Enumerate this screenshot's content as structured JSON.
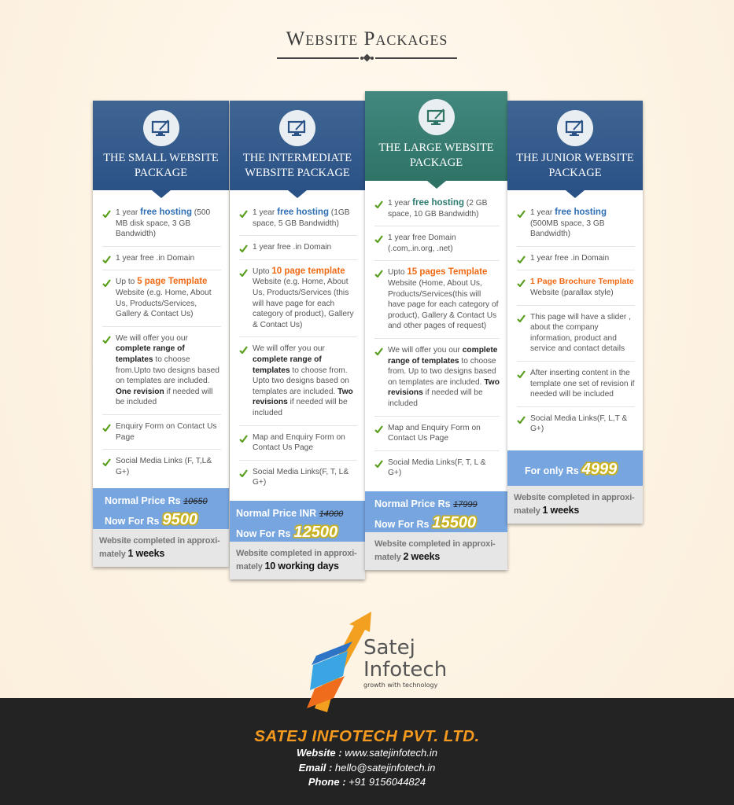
{
  "header": {
    "title": "Website Packages"
  },
  "packages": [
    {
      "title_line1": "THE SMALL WEBSITE",
      "title_line2": "PACKAGE",
      "icon": "monitor-pen-icon",
      "features": [
        {
          "pre": "1 year ",
          "hl": "free hosting",
          "post": " (500 MB disk space, 3 GB Bandwidth)"
        },
        {
          "pre": "1 year free .in Domain",
          "hl": "",
          "post": ""
        },
        {
          "pre": "Up to ",
          "hl": "5 page Template",
          "post": " Website (e.g. Home, About Us,  Products/Services,  Gallery & Contact Us)"
        },
        {
          "pre": "We will offer you our ",
          "b1": "complete range of templates",
          "mid": " to choose from.Upto two designs based on templates are included. ",
          "b2": "One revision",
          "post": " if needed will be included"
        },
        {
          "pre": "Enquiry Form on Contact Us Page",
          "hl": "",
          "post": ""
        },
        {
          "pre": "Social Media Links (F, T,L& G+)",
          "hl": "",
          "post": ""
        }
      ],
      "price_normal_label": "Normal Price Rs",
      "price_normal": "10650",
      "price_now_label": "Now For Rs",
      "price_now": "9500",
      "completion_text": "Website completed in approxi- mately ",
      "duration": "1 weeks"
    },
    {
      "title_line1": "THE INTERMEDIATE",
      "title_line2": "WEBSITE PACKAGE",
      "icon": "monitor-pen-icon",
      "features": [
        {
          "pre": "1 year ",
          "hl": "free hosting",
          "post": " (1GB space, 5 GB Bandwidth)"
        },
        {
          "pre": "1 year free .in Domain",
          "hl": "",
          "post": ""
        },
        {
          "pre": "Upto ",
          "hl": "10 page template",
          "post": " Website (e.g. Home, About Us, Products/Services (this will have page for each category of product), Gallery & Contact Us)"
        },
        {
          "pre": "We will offer you our ",
          "b1": "complete range of templates",
          "mid": " to choose from. Upto two designs based on templates are included. ",
          "b2": "Two revisions",
          "post": " if needed will be included"
        },
        {
          "pre": "Map and Enquiry Form on Contact Us Page",
          "hl": "",
          "post": ""
        },
        {
          "pre": "Social Media Links(F, T, L& G+)",
          "hl": "",
          "post": ""
        }
      ],
      "price_normal_label": "Normal Price INR",
      "price_normal": "14000",
      "price_now_label": "Now For Rs",
      "price_now": "12500",
      "completion_text": "Website completed in approxi- mately ",
      "duration": "10 working days"
    },
    {
      "title_line1": "THE LARGE WEBSITE",
      "title_line2": "PACKAGE",
      "icon": "monitor-pen-icon",
      "features": [
        {
          "pre": "1 year ",
          "hl": "free hosting",
          "post": " (2 GB space, 10 GB Bandwidth)"
        },
        {
          "pre": "1 year free Domain (.com,.in.org, .net)",
          "hl": "",
          "post": ""
        },
        {
          "pre": "Upto ",
          "hl": "15 pages Template",
          "post": " Website (Home, About Us, Products/Services(this will have page for each category of product), Gallery & Contact Us and other pages of request)"
        },
        {
          "pre": "We will offer you our ",
          "b1": "complete range of templates",
          "mid": " to choose from. Up to two designs based on templates are included. ",
          "b2": "Two revisions",
          "post": " if needed will be included"
        },
        {
          "pre": "Map and Enquiry Form on Contact Us Page",
          "hl": "",
          "post": ""
        },
        {
          "pre": "Social Media Links(F, T, L & G+)",
          "hl": "",
          "post": ""
        }
      ],
      "price_normal_label": "Normal Price Rs",
      "price_normal": "17999",
      "price_now_label": "Now For Rs",
      "price_now": "15500",
      "completion_text": "Website completed in approxi- mately ",
      "duration": "2 weeks"
    },
    {
      "title_line1": "THE JUNIOR WEBSITE",
      "title_line2": "PACKAGE",
      "icon": "monitor-pen-icon",
      "features": [
        {
          "pre": "1 year ",
          "hl": "free hosting",
          "post": " (500MB space, 3 GB Bandwidth)"
        },
        {
          "pre": "1 year free .in Domain",
          "hl": "",
          "post": ""
        },
        {
          "pre": "",
          "hl": "1 Page Brochure Template",
          "post": " Website (parallax style)"
        },
        {
          "pre": "This page will have a slider , about the company information, product and service and contact details",
          "hl": "",
          "post": ""
        },
        {
          "pre": "After inserting content in the template one set of revision if needed will be included",
          "hl": "",
          "post": ""
        },
        {
          "pre": "Social Media Links(F, L,T & G+)",
          "hl": "",
          "post": ""
        }
      ],
      "price_only_label": "For only Rs",
      "price_now": "4999",
      "completion_text": "Website completed in approxi- mately ",
      "duration": "1 weeks"
    }
  ],
  "logo": {
    "name_line1": "Satej",
    "name_line2": "Infotech",
    "tagline": "growth with technology"
  },
  "footer": {
    "company": "SATEJ INFOTECH PVT. LTD.",
    "website_label": "Website :",
    "website": "www.satejinfotech.in",
    "email_label": "Email :",
    "email": "hello@satejinfotech.in",
    "phone_label": "Phone :",
    "phone": "+91 9156044824"
  },
  "colors": {
    "card_blue": "#2b5286",
    "card_green": "#2f7367",
    "price_band": "#77a5e0",
    "highlight_orange": "#f06a14",
    "highlight_blue": "#2f6fb3",
    "footer_bg": "#232323",
    "footer_company": "#f59a1e"
  }
}
